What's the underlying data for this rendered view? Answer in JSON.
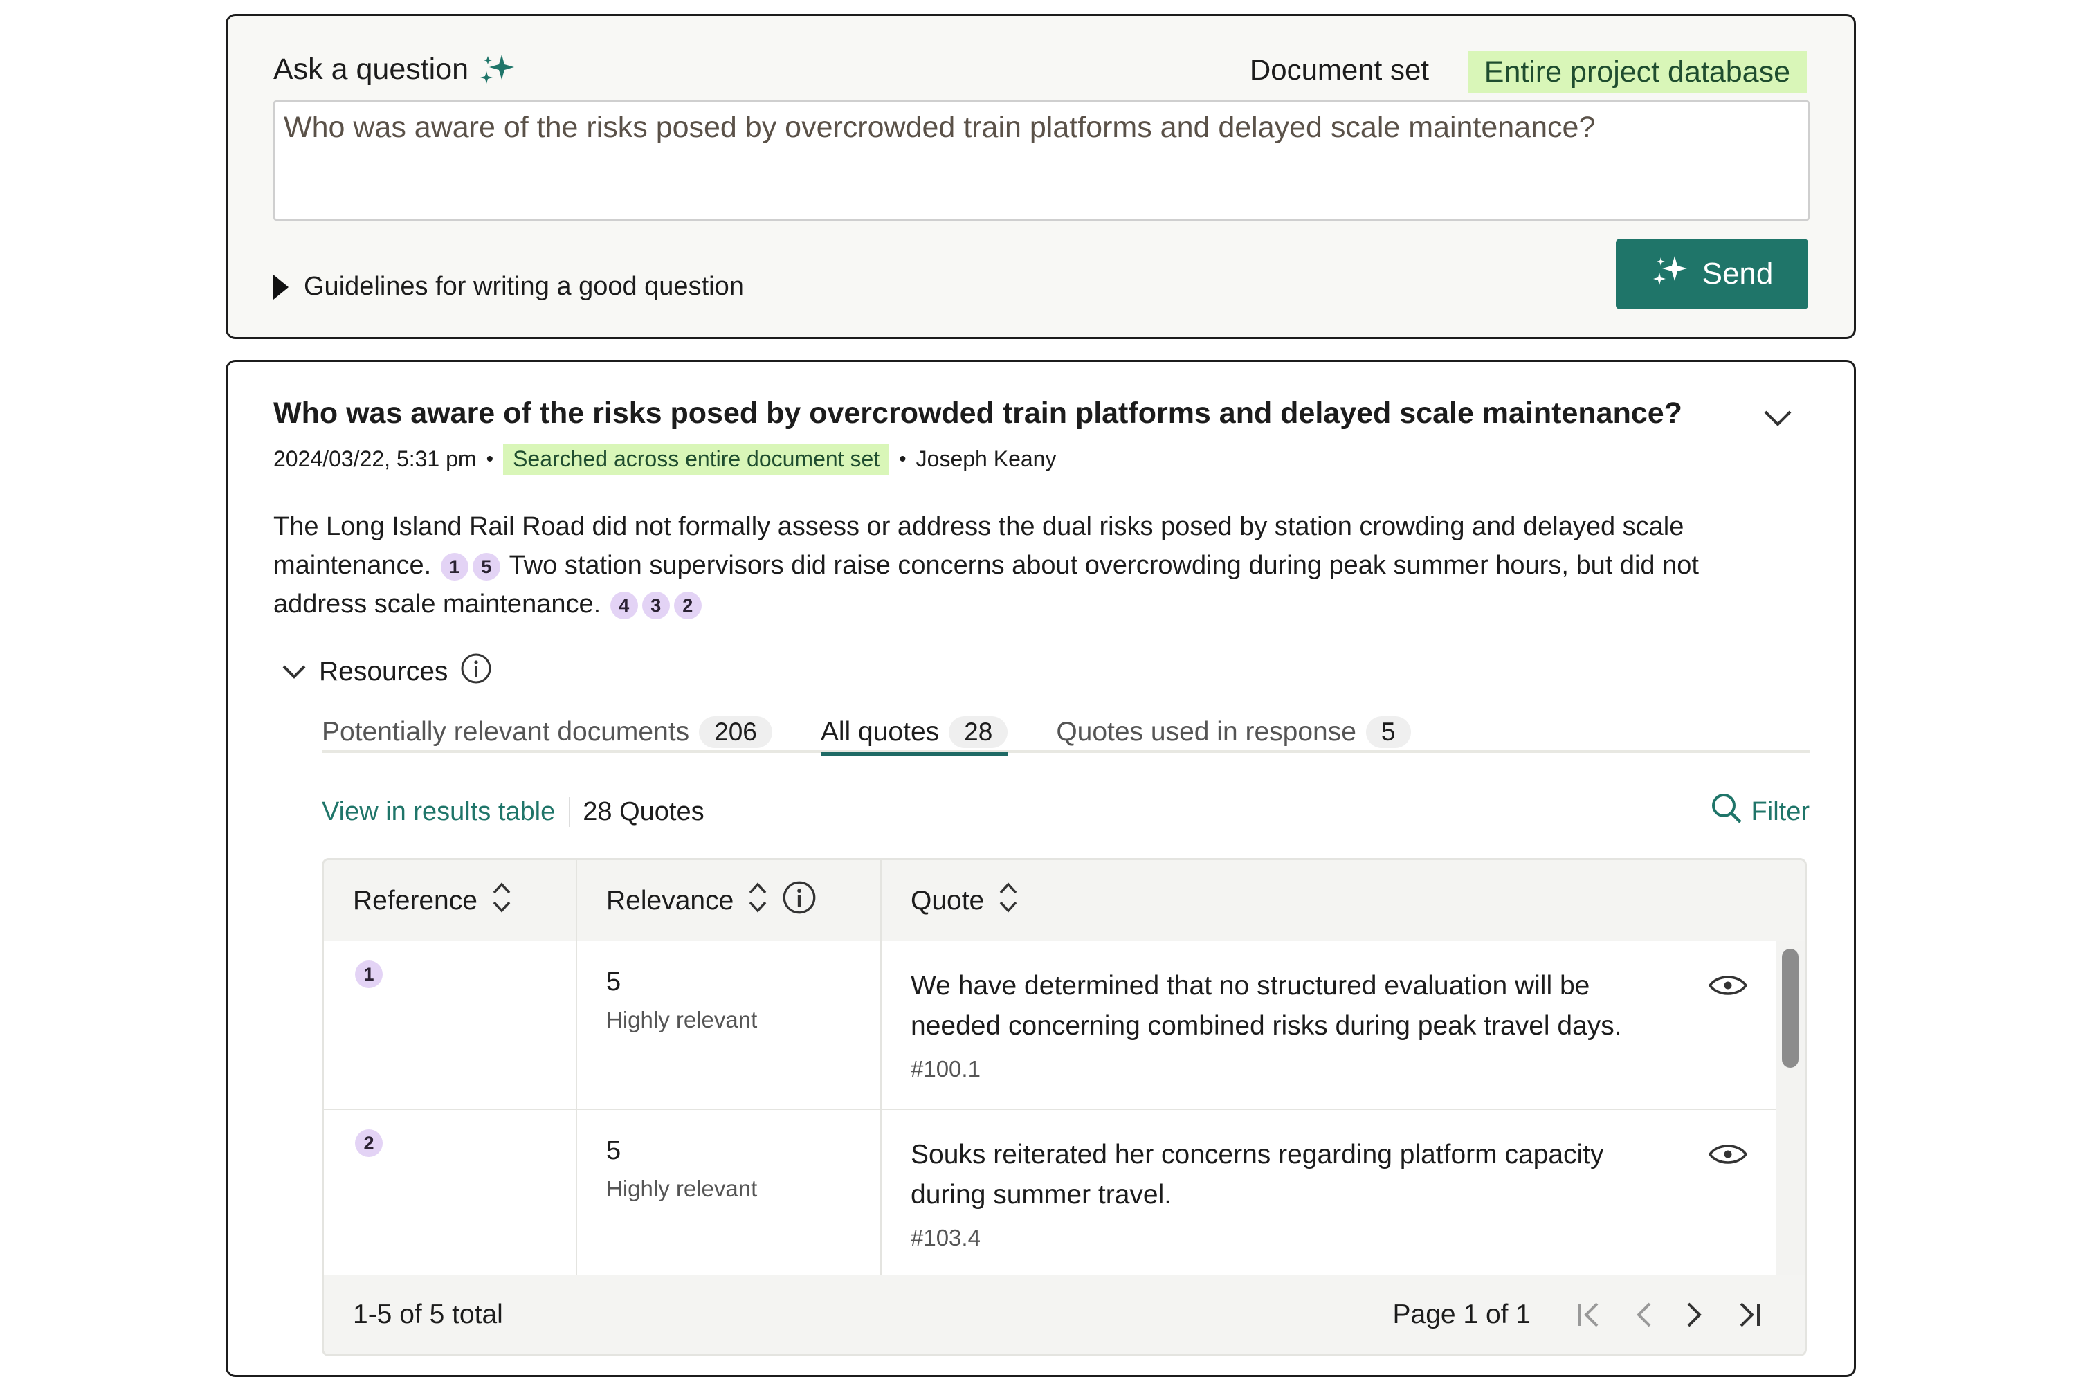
{
  "ask": {
    "title": "Ask a question",
    "docset_label": "Document set",
    "docset_value": "Entire project database",
    "question_value": "Who was aware of the risks posed by overcrowded train platforms and delayed scale maintenance?",
    "guidelines_label": "Guidelines for writing a good question",
    "send_label": "Send"
  },
  "response": {
    "question": "Who was aware of the risks posed by overcrowded train platforms and delayed scale maintenance?",
    "date": "2024/03/22, 5:31 pm",
    "scope_badge": "Searched across entire document set",
    "author": "Joseph Keany",
    "answer_part1": "The Long Island Rail Road did not formally assess or address the dual risks posed by station crowding and delayed scale maintenance.",
    "answer_part2": "Two station supervisors did raise concerns about overcrowding during peak summer hours, but did not address scale maintenance.",
    "citations_1": [
      "1",
      "5"
    ],
    "citations_2": [
      "4",
      "3",
      "2"
    ]
  },
  "resources": {
    "label": "Resources",
    "tabs": [
      {
        "label": "Potentially relevant documents",
        "count": "206"
      },
      {
        "label": "All quotes",
        "count": "28"
      },
      {
        "label": "Quotes used in response",
        "count": "5"
      }
    ],
    "view_link": "View in results table",
    "quotes_count": "28 Quotes",
    "filter_label": "Filter"
  },
  "table": {
    "headers": {
      "reference": "Reference",
      "relevance": "Relevance",
      "quote": "Quote"
    },
    "rows": [
      {
        "ref": "1",
        "relevance": "5",
        "relevance_label": "Highly relevant",
        "quote": "We have determined that no structured evaluation will be needed concerning combined risks during peak travel days.",
        "source": "#100.1"
      },
      {
        "ref": "2",
        "relevance": "5",
        "relevance_label": "Highly relevant",
        "quote": "Souks reiterated her concerns regarding platform capacity during summer travel.",
        "source": "#103.4"
      }
    ],
    "total": "1-5 of 5 total",
    "page": "Page 1 of 1"
  },
  "colors": {
    "accent": "#1f7569",
    "badge_green": "#d9f6b8",
    "citation_purple": "#e3d3f5"
  }
}
